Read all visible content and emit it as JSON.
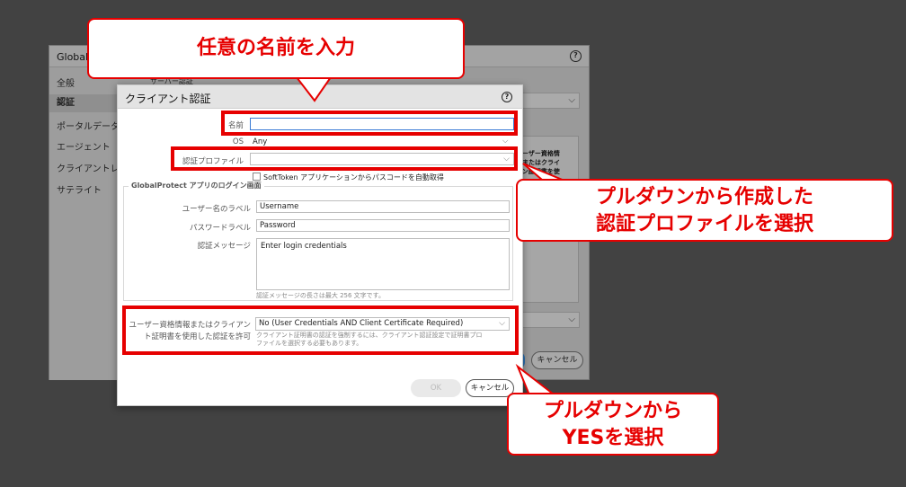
{
  "background_dialog": {
    "title": "Global",
    "help": "?",
    "sidebar": [
      {
        "label": "全般",
        "active": false
      },
      {
        "label": "認証",
        "active": true
      },
      {
        "label": "ポータルデータ",
        "active": false
      },
      {
        "label": "エージェント",
        "active": false
      },
      {
        "label": "クライアントレ",
        "active": false
      },
      {
        "label": "サテライト",
        "active": false
      }
    ],
    "section_label": "サーバー認証",
    "column_header": "ユーザー資格情報またはクライアン証明書を使用",
    "cancel_label": "キャンセル"
  },
  "dialog": {
    "title": "クライアント認証",
    "help": "?",
    "name": {
      "label": "名前",
      "value": ""
    },
    "os": {
      "label": "OS",
      "value": "Any"
    },
    "auth_profile": {
      "label": "認証プロファイル",
      "value": ""
    },
    "softtoken": {
      "label": "SoftToken アプリケーションからパスコードを自動取得",
      "checked": false
    },
    "login_section": {
      "legend": "GlobalProtect アプリのログイン画面",
      "username_label": {
        "label": "ユーザー名のラベル",
        "value": "Username"
      },
      "password_label": {
        "label": "パスワードラベル",
        "value": "Password"
      },
      "auth_message": {
        "label": "認証メッセージ",
        "value": "Enter login credentials",
        "hint": "認証メッセージの長さは最大 256 文字です。"
      }
    },
    "allow_cert": {
      "label_line1": "ユーザー資格情報またはクライアン",
      "label_line2": "ト証明書を使用した認証を許可",
      "value": "No (User Credentials AND Client Certificate Required)",
      "hint_line1": "クライアント証明書の認証を強制するには、クライアント認証設定で証明書プロ",
      "hint_line2": "ファイルを選択する必要もあります。"
    },
    "ok_label": "OK",
    "cancel_label": "キャンセル"
  },
  "annotations": {
    "callout1": "任意の名前を入力",
    "callout2_line1": "プルダウンから作成した",
    "callout2_line2": "認証プロファイルを選択",
    "callout3_line1": "プルダウンから",
    "callout3_line2": "YESを選択",
    "color": "#e60000"
  }
}
